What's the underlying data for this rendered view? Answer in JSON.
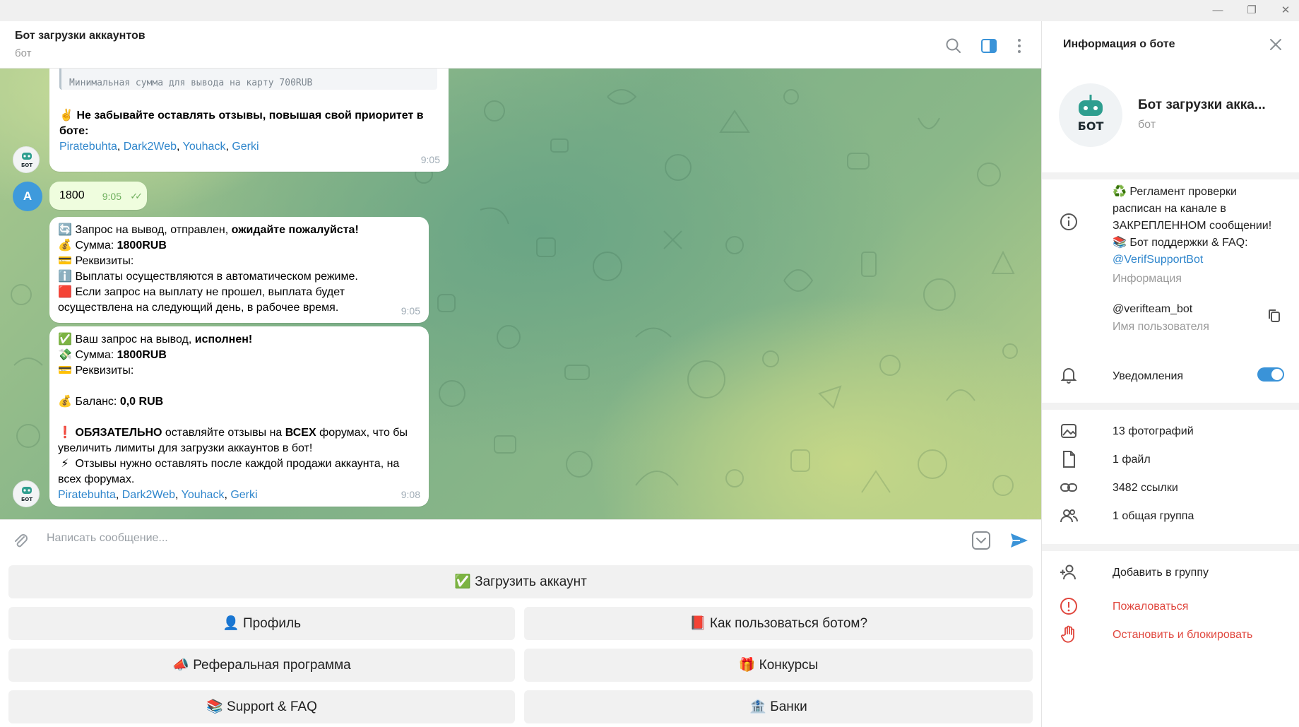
{
  "window": {
    "minimize_glyph": "—",
    "restore_glyph": "❐",
    "close_glyph": "✕"
  },
  "chat": {
    "title": "Бот загрузки аккаунтов",
    "subtitle": "бот"
  },
  "messages": {
    "quote_text": "Минимальная сумма для вывода на карту 700RUB",
    "m1": {
      "emoji": "✌️",
      "line1": "Не забывайте оставлять отзывы, повышая свой приоритет в",
      "line2": "боте:",
      "links": [
        "Piratebuhta",
        "Dark2Web",
        "Youhack",
        "Gerki"
      ],
      "time": "9:05"
    },
    "m2": {
      "avatar_letter": "A",
      "text": "1800",
      "time": "9:05",
      "status": "✓✓"
    },
    "m3": {
      "l1_emoji": "🔄",
      "l1_a": "Запрос на вывод,  отправлен,",
      "l1_b": "ожидайте пожалуйста!",
      "l2_emoji": "💰",
      "l2_a": "Сумма:",
      "l2_b": "1800RUB",
      "l3_emoji": "💳",
      "l3_a": "Реквизиты:",
      "l4_emoji": "ℹ️",
      "l4": "Выплаты осуществляются в автоматическом режиме.",
      "l5_emoji": "🟥",
      "l5": "Если запрос на выплату не прошел, выплата будет",
      "l6": "осуществлена на следующий день, в рабочее время.",
      "time": "9:05"
    },
    "m4": {
      "l1_emoji": "✅",
      "l1_a": "Ваш запрос на вывод,",
      "l1_b": "исполнен!",
      "l2_emoji": "💸",
      "l2_a": "Сумма:",
      "l2_b": "1800RUB",
      "l3_emoji": "💳",
      "l3_a": "Реквизиты:",
      "l4_emoji": "💰",
      "l4_a": "Баланс:",
      "l4_b": "0,0 RUB",
      "l5_emoji": "❗",
      "l5_b1": "ОБЯЗАТЕЛЬНО",
      "l5_a": "оставляйте отзывы на",
      "l5_b2": "ВСЕХ",
      "l5_c": "форумах, что бы",
      "l6": "увеличить лимиты для загрузки аккаунтов в бот!",
      "l7_emoji": "⚡",
      "l7": "Отзывы нужно оставлять после каждой продажи аккаунта, на",
      "l8": "всех форумах.",
      "links": [
        "Piratebuhta",
        "Dark2Web",
        "Youhack",
        "Gerki"
      ],
      "time": "9:08"
    },
    "bot_avatar_text": "БОТ"
  },
  "composer": {
    "placeholder": "Написать сообщение..."
  },
  "keyboard": {
    "buttons": [
      "✅ Загрузить аккаунт",
      "👤 Профиль",
      "📕 Как пользоваться ботом?",
      "📣 Реферальная программа",
      "🎁 Конкурсы",
      "📚 Support & FAQ",
      "🏦 Банки"
    ]
  },
  "panel": {
    "title": "Информация о боте",
    "name": "Бот загрузки акка...",
    "subtitle": "бот",
    "avatar_text": "БОТ",
    "info": {
      "l1": "♻️ Регламент проверки",
      "l2": "расписан на канале в",
      "l3": "ЗАКРЕПЛЕННОМ сообщении!",
      "l4": "📚 Бот поддержки & FAQ:",
      "link": "@VerifSupportBot",
      "caption": "Информация"
    },
    "username": {
      "value": "@verifteam_bot",
      "caption": "Имя пользователя"
    },
    "notifications": {
      "label": "Уведомления",
      "enabled": true
    },
    "media": {
      "photos": "13 фотографий",
      "files": "1 файл",
      "links": "3482 ссылки",
      "groups": "1 общая группа"
    },
    "actions": {
      "add_to_group": "Добавить в группу",
      "report": "Пожаловаться",
      "block": "Остановить и блокировать"
    }
  },
  "colors": {
    "accent": "#3a93d8",
    "link": "#2f86cc",
    "danger": "#e0473e",
    "outgoing_bubble": "#effdde"
  }
}
